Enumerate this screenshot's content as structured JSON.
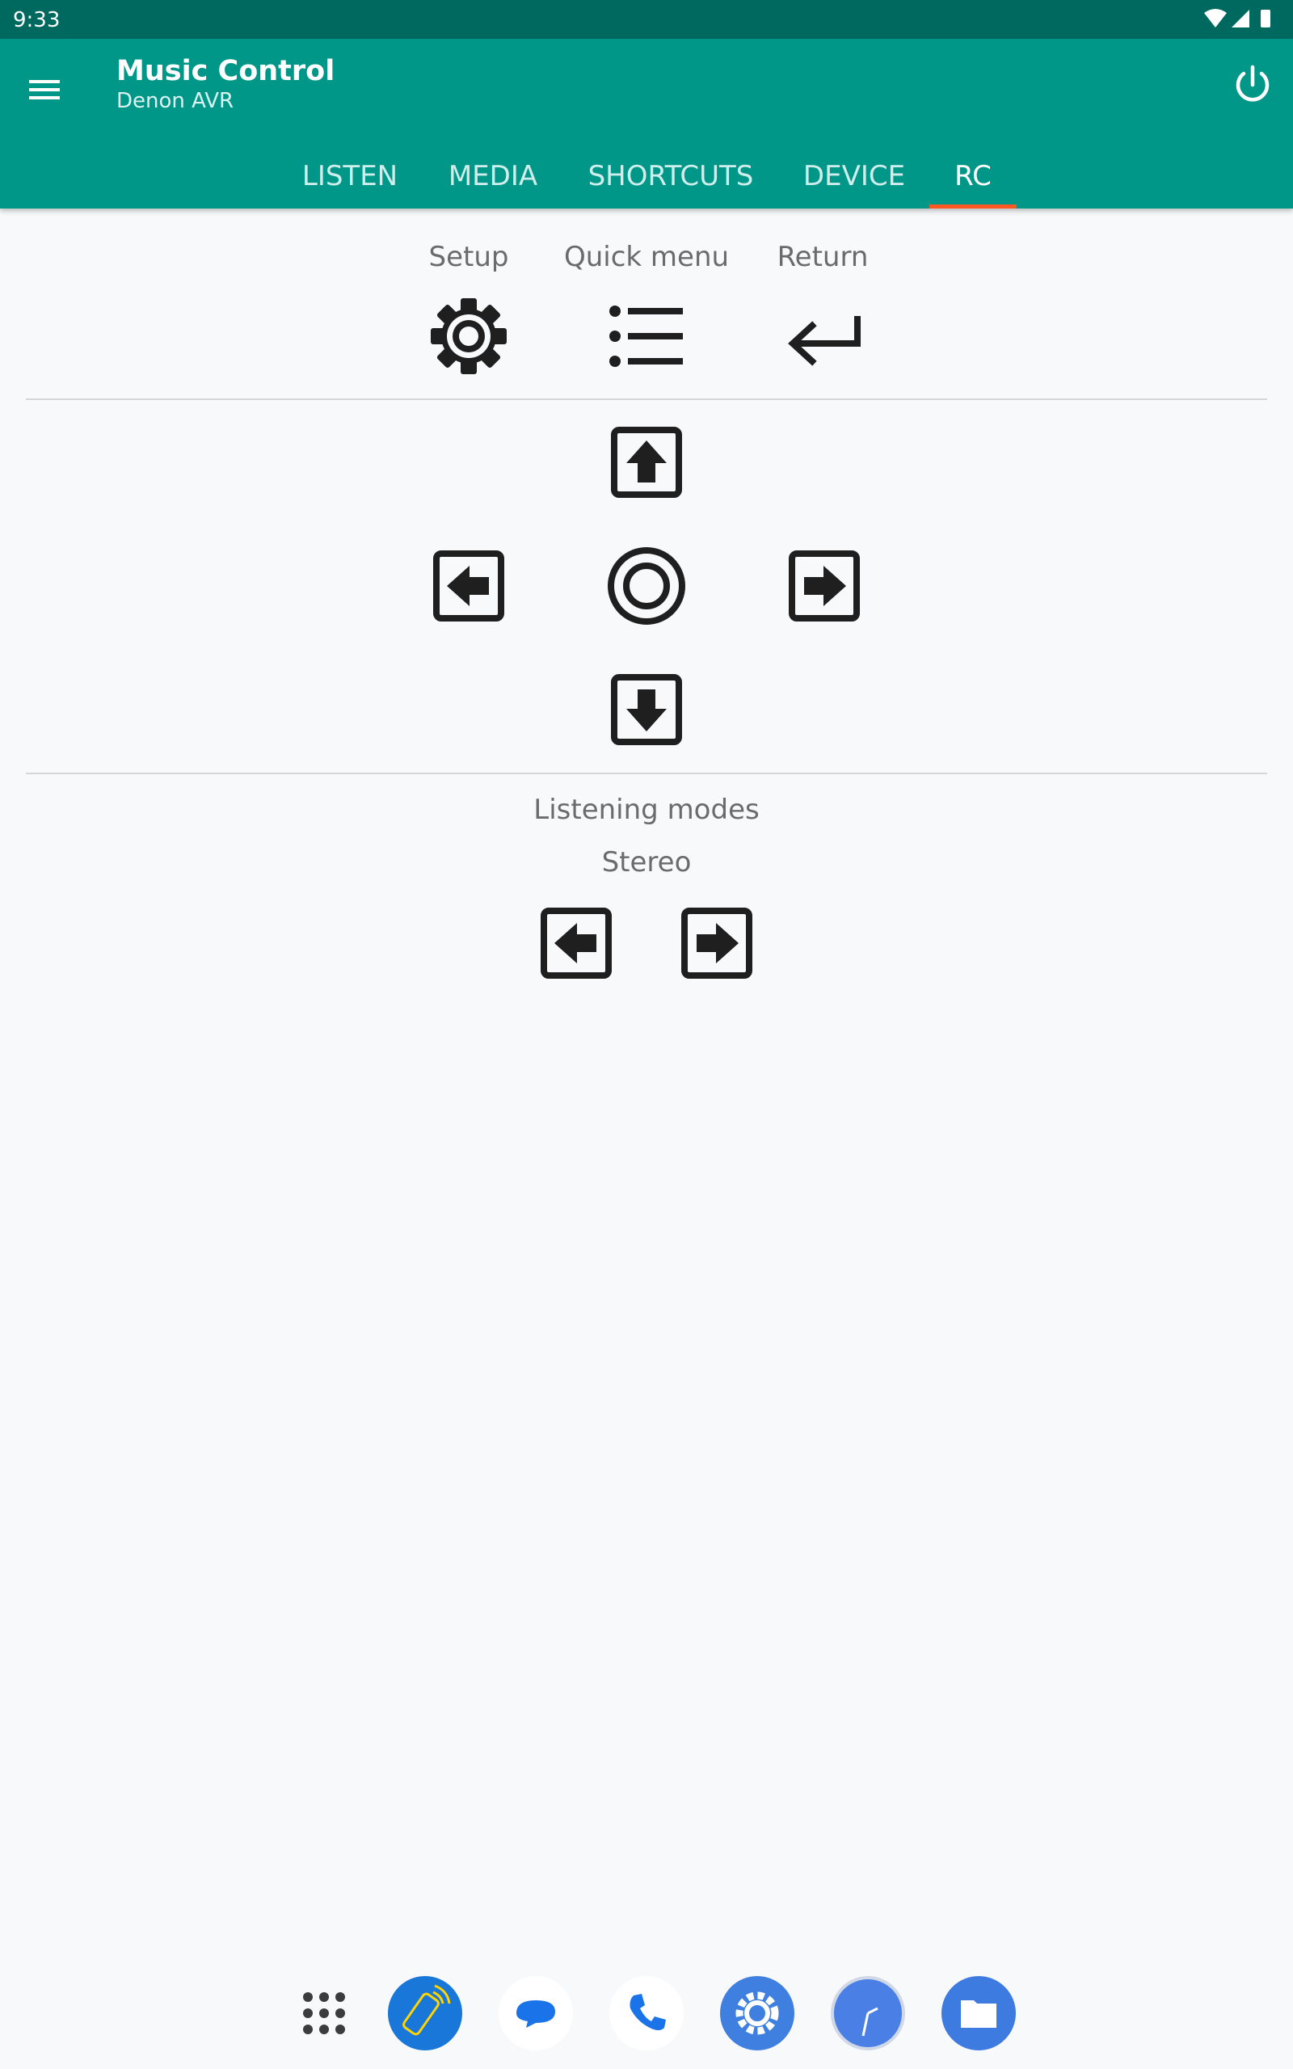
{
  "status": {
    "time": "9:33"
  },
  "app": {
    "title": "Music Control",
    "subtitle": "Denon AVR"
  },
  "tabs": [
    {
      "label": "LISTEN"
    },
    {
      "label": "MEDIA"
    },
    {
      "label": "SHORTCUTS"
    },
    {
      "label": "DEVICE"
    },
    {
      "label": "RC",
      "active": true
    }
  ],
  "rc": {
    "setup_label": "Setup",
    "quick_menu_label": "Quick menu",
    "return_label": "Return",
    "listening_modes_label": "Listening modes",
    "current_mode": "Stereo"
  },
  "colors": {
    "toolbar": "#009688",
    "statusbar": "#00695f",
    "accent": "#ff5722"
  },
  "dock": [
    "apps-grid-icon",
    "remote-app-icon",
    "messages-icon",
    "phone-icon",
    "settings-icon",
    "clock-icon",
    "files-icon"
  ]
}
